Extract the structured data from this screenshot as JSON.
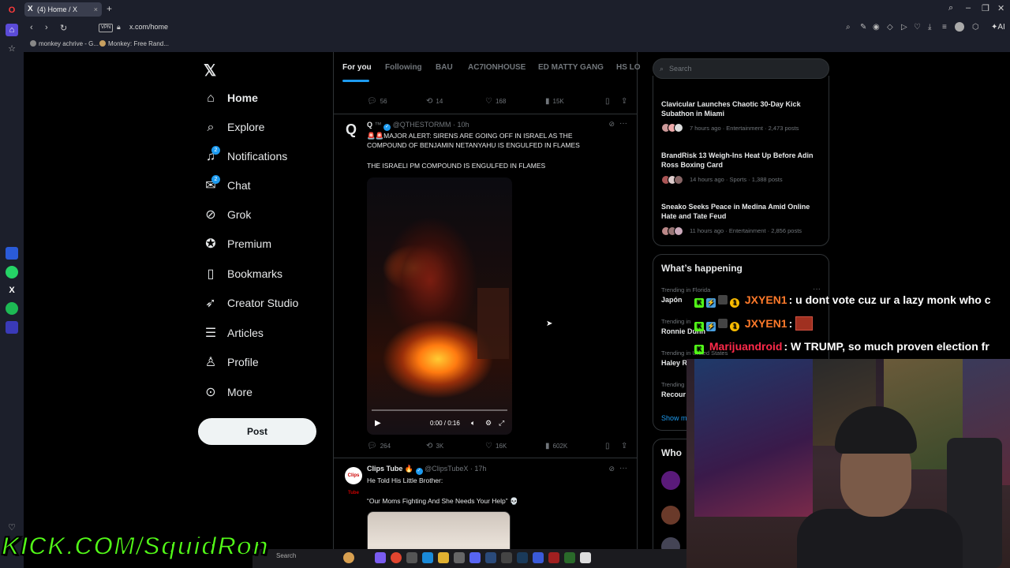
{
  "browser": {
    "tab_title": "(4) Home / X",
    "url": "x.com/home",
    "vpn_label": "VPN",
    "ai_label": "AI",
    "bookmarks": [
      "monkey achrive - G...",
      "Monkey: Free Rand..."
    ]
  },
  "nav": {
    "items": [
      {
        "label": "Home",
        "icon": "home-icon"
      },
      {
        "label": "Explore",
        "icon": "search-icon"
      },
      {
        "label": "Notifications",
        "icon": "bell-icon",
        "badge": "2"
      },
      {
        "label": "Chat",
        "icon": "mail-icon",
        "badge": "2"
      },
      {
        "label": "Grok",
        "icon": "grok-icon"
      },
      {
        "label": "Premium",
        "icon": "premium-icon"
      },
      {
        "label": "Bookmarks",
        "icon": "bookmark-icon"
      },
      {
        "label": "Creator Studio",
        "icon": "rocket-icon"
      },
      {
        "label": "Articles",
        "icon": "articles-icon"
      },
      {
        "label": "Profile",
        "icon": "person-icon"
      },
      {
        "label": "More",
        "icon": "more-icon"
      }
    ],
    "post_label": "Post"
  },
  "feed": {
    "tabs": [
      "For you",
      "Following",
      "BAU",
      "AC7IONHOUSE",
      "ED MATTY GANG",
      "HS LO"
    ],
    "prev_tweet_stats": {
      "replies": "56",
      "reposts": "14",
      "likes": "168",
      "views": "15K"
    },
    "tweet1": {
      "name": "Q",
      "handle": "@QTHESTORMM",
      "time": "10h",
      "text1": "🚨🚨MAJOR ALERT: SIRENS ARE GOING OFF IN ISRAEL AS THE COMPOUND OF BENJAMIN NETANYAHU IS ENGULFED IN FLAMES",
      "text2": "THE ISRAELI PM COMPOUND IS ENGULFED IN FLAMES",
      "video_time": "0:00 / 0:16",
      "stats": {
        "replies": "264",
        "reposts": "3K",
        "likes": "16K",
        "views": "602K"
      }
    },
    "tweet2": {
      "name": "Clips Tube 🔥",
      "handle": "@ClipsTubeX",
      "time": "17h",
      "avatar_text": "Clips Tube",
      "text1": "He Told His Little Brother:",
      "text2": "“Our Moms Fighting And She Needs Your Help” 💀"
    }
  },
  "right": {
    "search_placeholder": "Search",
    "stories": [
      {
        "title": "Clavicular Launches Chaotic 30-Day Kick Subathon in Miami",
        "meta": "7 hours ago · Entertainment · 2,473 posts"
      },
      {
        "title": "BrandRisk 13 Weigh-Ins Heat Up Before Adin Ross Boxing Card",
        "meta": "14 hours ago · Sports · 1,388 posts"
      },
      {
        "title": "Sneako Seeks Peace in Medina Amid Online Hate and Tate Feud",
        "meta": "11 hours ago · Entertainment · 2,856 posts"
      }
    ],
    "whats_happening": "What’s happening",
    "trends": [
      {
        "context": "Trending in Florida",
        "name": "Japón"
      },
      {
        "context": "Trending in",
        "name": "Ronnie Dunn"
      },
      {
        "context": "Trending in United States",
        "name": "Haley Ro"
      },
      {
        "context": "Trending",
        "name": "Recour"
      }
    ],
    "show_more": "Show m",
    "who_to_follow": "Who"
  },
  "chat": [
    {
      "user": "JXYEN1",
      "message": ": u dont vote cuz ur a lazy monk who c",
      "user_color": "#ff7a2a"
    },
    {
      "user": "JXYEN1",
      "message": ":",
      "user_color": "#ff7a2a"
    },
    {
      "user": "Marijuandroid",
      "message": ": W TRUMP, so much proven election fr",
      "user_color": "#ff2a4a"
    }
  ],
  "overlay": {
    "kick_text": "KICK.COM/SquidRon"
  },
  "taskbar": {
    "search_label": "Search"
  }
}
